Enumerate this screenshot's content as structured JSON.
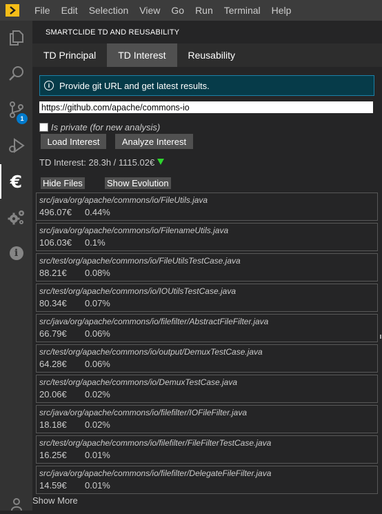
{
  "menu": {
    "logo_icon": "chevron-right-icon",
    "items": [
      "File",
      "Edit",
      "Selection",
      "View",
      "Go",
      "Run",
      "Terminal",
      "Help"
    ]
  },
  "activity_bar": {
    "icons": [
      "explorer-icon",
      "search-icon",
      "source-control-icon",
      "run-debug-icon",
      "euro-icon",
      "settings-gears-icon",
      "info-icon",
      "account-icon"
    ],
    "source_control_badge": "1",
    "euro_glyph": "€",
    "info_glyph": "i"
  },
  "panel": {
    "title": "SMARTCLIDE TD AND REUSABILITY",
    "tabs": [
      {
        "label": "TD Principal",
        "active": false
      },
      {
        "label": "TD Interest",
        "active": true
      },
      {
        "label": "Reusability",
        "active": false
      }
    ],
    "info_message": "Provide git URL and get latest results.",
    "url_value": "https://github.com/apache/commons-io",
    "private_label": "Is private (for new analysis)",
    "private_checked": false,
    "load_button": "Load Interest",
    "analyze_button": "Analyze Interest",
    "td_interest_text": "TD Interest: 28.3h / 1115.02€",
    "trend_color": "#2ed52e",
    "hide_files_button": "Hide Files",
    "show_evolution_button": "Show Evolution",
    "files": [
      {
        "path": "src/java/org/apache/commons/io/FileUtils.java",
        "cost": "496.07€",
        "percent": "0.44%"
      },
      {
        "path": "src/java/org/apache/commons/io/FilenameUtils.java",
        "cost": "106.03€",
        "percent": "0.1%"
      },
      {
        "path": "src/test/org/apache/commons/io/FileUtilsTestCase.java",
        "cost": "88.21€",
        "percent": "0.08%"
      },
      {
        "path": "src/test/org/apache/commons/io/IOUtilsTestCase.java",
        "cost": "80.34€",
        "percent": "0.07%"
      },
      {
        "path": "src/java/org/apache/commons/io/filefilter/AbstractFileFilter.java",
        "cost": "66.79€",
        "percent": "0.06%"
      },
      {
        "path": "src/test/org/apache/commons/io/output/DemuxTestCase.java",
        "cost": "64.28€",
        "percent": "0.06%"
      },
      {
        "path": "src/test/org/apache/commons/io/DemuxTestCase.java",
        "cost": "20.06€",
        "percent": "0.02%"
      },
      {
        "path": "src/java/org/apache/commons/io/filefilter/IOFileFilter.java",
        "cost": "18.18€",
        "percent": "0.02%"
      },
      {
        "path": "src/test/org/apache/commons/io/filefilter/FileFilterTestCase.java",
        "cost": "16.25€",
        "percent": "0.01%"
      },
      {
        "path": "src/java/org/apache/commons/io/filefilter/DelegateFileFilter.java",
        "cost": "14.59€",
        "percent": "0.01%"
      }
    ],
    "show_more": "Show More"
  }
}
